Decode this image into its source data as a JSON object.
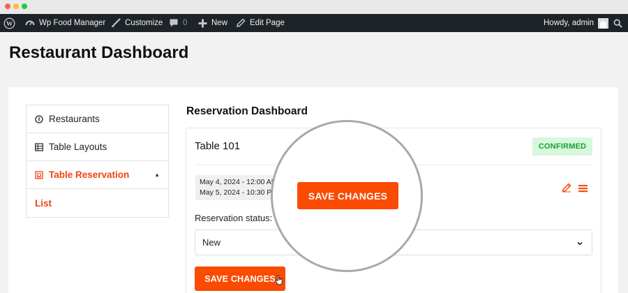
{
  "adminbar": {
    "site_name": "Wp Food Manager",
    "customize": "Customize",
    "comments_count": "0",
    "new": "New",
    "edit_page": "Edit Page",
    "howdy": "Howdy, admin"
  },
  "page": {
    "title": "Restaurant Dashboard"
  },
  "sidebar": {
    "items": [
      {
        "label": "Restaurants",
        "icon": "info-circle-icon"
      },
      {
        "label": "Table Layouts",
        "icon": "table-grid-icon"
      },
      {
        "label": "Table Reservation",
        "icon": "calendar-icon",
        "active": true
      }
    ],
    "subitems": [
      {
        "label": "List"
      }
    ]
  },
  "main": {
    "title": "Reservation Dashboard",
    "card": {
      "table_name": "Table 101",
      "status_badge": "CONFIRMED",
      "date_start": "May 4, 2024 - 12:00 AM",
      "date_end": "May 5, 2024 - 10:30 PM",
      "status_label": "Reservation status:",
      "status_value": "New",
      "save_label": "SAVE CHANGES"
    },
    "magnified_save_label": "SAVE CHANGES"
  },
  "colors": {
    "accent": "#fb4a02",
    "active_text": "#f04410",
    "badge_bg": "#d7f8dc",
    "badge_text": "#1a9d34",
    "adminbar_bg": "#1d2327"
  }
}
